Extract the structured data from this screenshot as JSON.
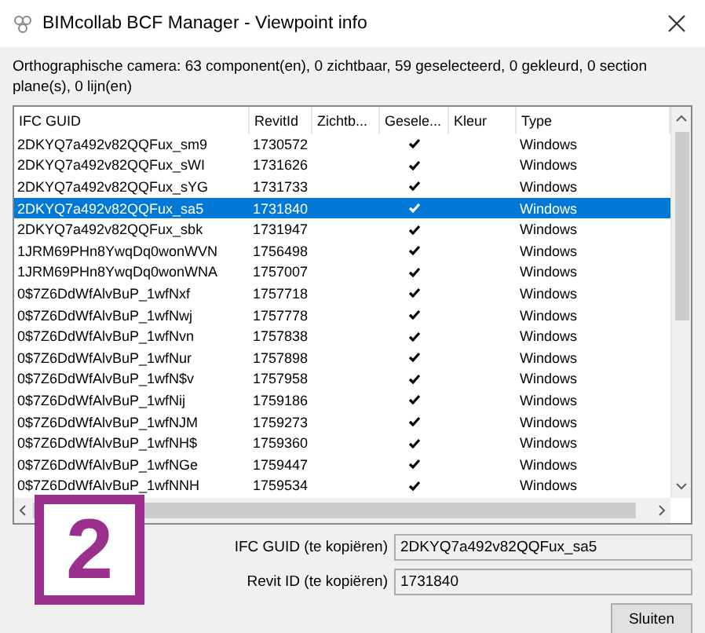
{
  "window": {
    "title": "BIMcollab BCF Manager - Viewpoint info"
  },
  "summary": "Orthographische camera: 63 component(en), 0 zichtbaar, 59 geselecteerd, 0 gekleurd, 0 section plane(s), 0 lijn(en)",
  "table": {
    "columns": [
      "IFC GUID",
      "RevitId",
      "Zichtb...",
      "Gesele...",
      "Kleur",
      "Type"
    ],
    "rows": [
      {
        "guid": "2DKYQ7a492v82QQFux_sm9",
        "revit_id": "1730572",
        "geselecteerd": true,
        "type": "Windows",
        "selected": false
      },
      {
        "guid": "2DKYQ7a492v82QQFux_sWI",
        "revit_id": "1731626",
        "geselecteerd": true,
        "type": "Windows",
        "selected": false
      },
      {
        "guid": "2DKYQ7a492v82QQFux_sYG",
        "revit_id": "1731733",
        "geselecteerd": true,
        "type": "Windows",
        "selected": false
      },
      {
        "guid": "2DKYQ7a492v82QQFux_sa5",
        "revit_id": "1731840",
        "geselecteerd": true,
        "type": "Windows",
        "selected": true
      },
      {
        "guid": "2DKYQ7a492v82QQFux_sbk",
        "revit_id": "1731947",
        "geselecteerd": true,
        "type": "Windows",
        "selected": false
      },
      {
        "guid": "1JRM69PHn8YwqDq0wonWVN",
        "revit_id": "1756498",
        "geselecteerd": true,
        "type": "Windows",
        "selected": false
      },
      {
        "guid": "1JRM69PHn8YwqDq0wonWNA",
        "revit_id": "1757007",
        "geselecteerd": true,
        "type": "Windows",
        "selected": false
      },
      {
        "guid": "0$7Z6DdWfAlvBuP_1wfNxf",
        "revit_id": "1757718",
        "geselecteerd": true,
        "type": "Windows",
        "selected": false
      },
      {
        "guid": "0$7Z6DdWfAlvBuP_1wfNwj",
        "revit_id": "1757778",
        "geselecteerd": true,
        "type": "Windows",
        "selected": false
      },
      {
        "guid": "0$7Z6DdWfAlvBuP_1wfNvn",
        "revit_id": "1757838",
        "geselecteerd": true,
        "type": "Windows",
        "selected": false
      },
      {
        "guid": "0$7Z6DdWfAlvBuP_1wfNur",
        "revit_id": "1757898",
        "geselecteerd": true,
        "type": "Windows",
        "selected": false
      },
      {
        "guid": "0$7Z6DdWfAlvBuP_1wfN$v",
        "revit_id": "1757958",
        "geselecteerd": true,
        "type": "Windows",
        "selected": false
      },
      {
        "guid": "0$7Z6DdWfAlvBuP_1wfNij",
        "revit_id": "1759186",
        "geselecteerd": true,
        "type": "Windows",
        "selected": false
      },
      {
        "guid": "0$7Z6DdWfAlvBuP_1wfNJM",
        "revit_id": "1759273",
        "geselecteerd": true,
        "type": "Windows",
        "selected": false
      },
      {
        "guid": "0$7Z6DdWfAlvBuP_1wfNH$",
        "revit_id": "1759360",
        "geselecteerd": true,
        "type": "Windows",
        "selected": false
      },
      {
        "guid": "0$7Z6DdWfAlvBuP_1wfNGe",
        "revit_id": "1759447",
        "geselecteerd": true,
        "type": "Windows",
        "selected": false
      },
      {
        "guid": "0$7Z6DdWfAlvBuP_1wfNNH",
        "revit_id": "1759534",
        "geselecteerd": true,
        "type": "Windows",
        "selected": false
      }
    ]
  },
  "fields": [
    {
      "label": "IFC GUID (te kopiëren)",
      "value": "2DKYQ7a492v82QQFux_sa5"
    },
    {
      "label": "Revit ID (te kopiëren)",
      "value": "1731840"
    }
  ],
  "buttons": [
    "Sluiten"
  ],
  "badge": "2"
}
